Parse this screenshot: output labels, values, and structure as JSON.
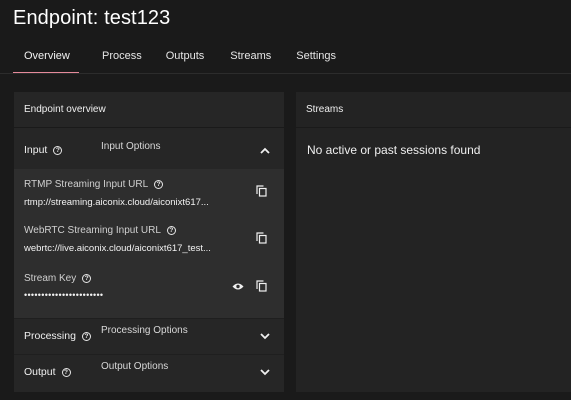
{
  "page": {
    "title": "Endpoint: test123"
  },
  "tabs": [
    {
      "label": "Overview",
      "active": true
    },
    {
      "label": "Process",
      "active": false
    },
    {
      "label": "Outputs",
      "active": false
    },
    {
      "label": "Streams",
      "active": false
    },
    {
      "label": "Settings",
      "active": false
    }
  ],
  "overview": {
    "header": "Endpoint overview",
    "input": {
      "title": "Input",
      "subtitle": "Input Options",
      "expanded": true,
      "fields": [
        {
          "label": "RTMP Streaming Input URL",
          "value": "rtmp://streaming.aiconix.cloud/aiconixt617..."
        },
        {
          "label": "WebRTC Streaming Input URL",
          "value": "webrtc://live.aiconix.cloud/aiconixt617_test..."
        },
        {
          "label": "Stream Key",
          "value": "•••••••••••••••••••••••"
        }
      ]
    },
    "processing": {
      "title": "Processing",
      "subtitle": "Processing Options",
      "expanded": false
    },
    "output": {
      "title": "Output",
      "subtitle": "Output Options",
      "expanded": false
    }
  },
  "streams": {
    "header": "Streams",
    "empty_message": "No active or past sessions found"
  },
  "colors": {
    "accent": "#e58a9b",
    "background": "#1a1a1a",
    "panel": "#262626"
  }
}
